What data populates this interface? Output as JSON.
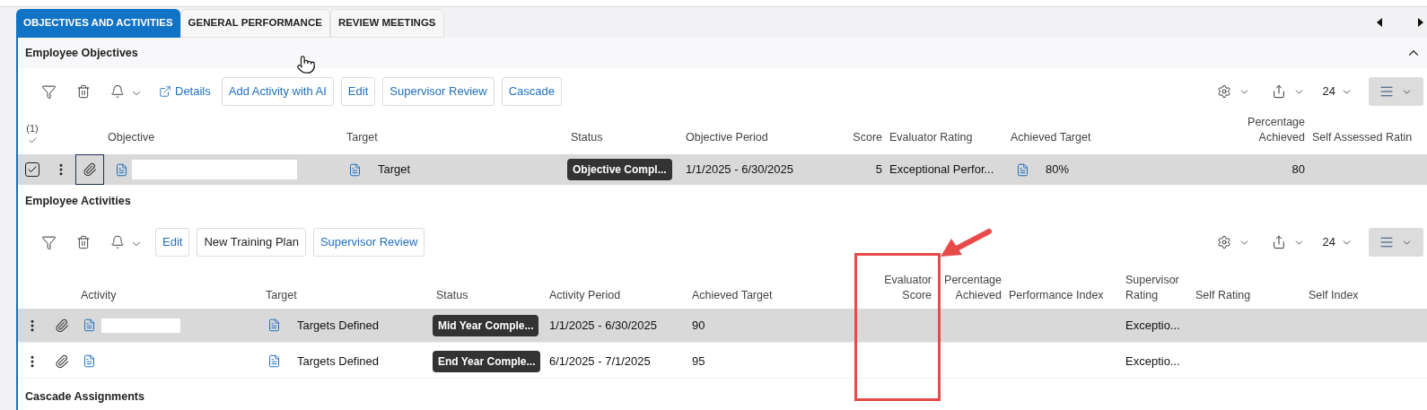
{
  "tabs": [
    {
      "label": "OBJECTIVES AND ACTIVITIES",
      "selected": true
    },
    {
      "label": "GENERAL PERFORMANCE",
      "selected": false
    },
    {
      "label": "REVIEW MEETINGS",
      "selected": false
    }
  ],
  "objectives": {
    "title": "Employee Objectives",
    "expanded": true,
    "buttons": [
      {
        "label": "Details",
        "kind": "link"
      },
      {
        "label": "Add Activity with AI",
        "kind": "outline"
      },
      {
        "label": "Edit",
        "kind": "outline"
      },
      {
        "label": "Supervisor Review",
        "kind": "outline"
      },
      {
        "label": "Cascade",
        "kind": "outline"
      }
    ],
    "page_size": "24",
    "selection_count": "(1)",
    "columns": [
      "Objective",
      "Target",
      "Status",
      "Objective Period",
      "Score",
      "Evaluator Rating",
      "Achieved Target",
      "Percentage Achieved",
      "Self Assessed Ratin"
    ],
    "rows": [
      {
        "selected": true,
        "checked": true,
        "redacted": true,
        "target": "Target",
        "status": "Objective Compl...",
        "period": "1/1/2025 - 6/30/2025",
        "score": "5",
        "evaluator_rating": "Exceptional Perfor...",
        "achieved_target": "80%",
        "percentage_achieved": "80"
      }
    ]
  },
  "activities": {
    "title": "Employee Activities",
    "buttons": [
      {
        "label": "Edit",
        "kind": "outline"
      },
      {
        "label": "New Training Plan",
        "kind": "plain"
      },
      {
        "label": "Supervisor Review",
        "kind": "outline"
      }
    ],
    "page_size": "24",
    "columns": [
      "Activity",
      "Target",
      "Status",
      "Activity Period",
      "Achieved Target",
      "Evaluator Score",
      "Percentage Achieved",
      "Performance Index",
      "Supervisor Rating",
      "Self Rating",
      "Self Index"
    ],
    "rows": [
      {
        "selected": true,
        "redacted": true,
        "target": "Targets Defined",
        "status": "Mid Year Comple...",
        "period": "1/1/2025 - 6/30/2025",
        "achieved_target": "90",
        "supervisor_rating": "Exceptio..."
      },
      {
        "selected": false,
        "redacted": false,
        "target": "Targets Defined",
        "status": "End Year Comple...",
        "period": "6/1/2025 - 7/1/2025",
        "achieved_target": "95",
        "supervisor_rating": "Exceptio..."
      }
    ]
  },
  "cascade": {
    "title": "Cascade Assignments"
  }
}
